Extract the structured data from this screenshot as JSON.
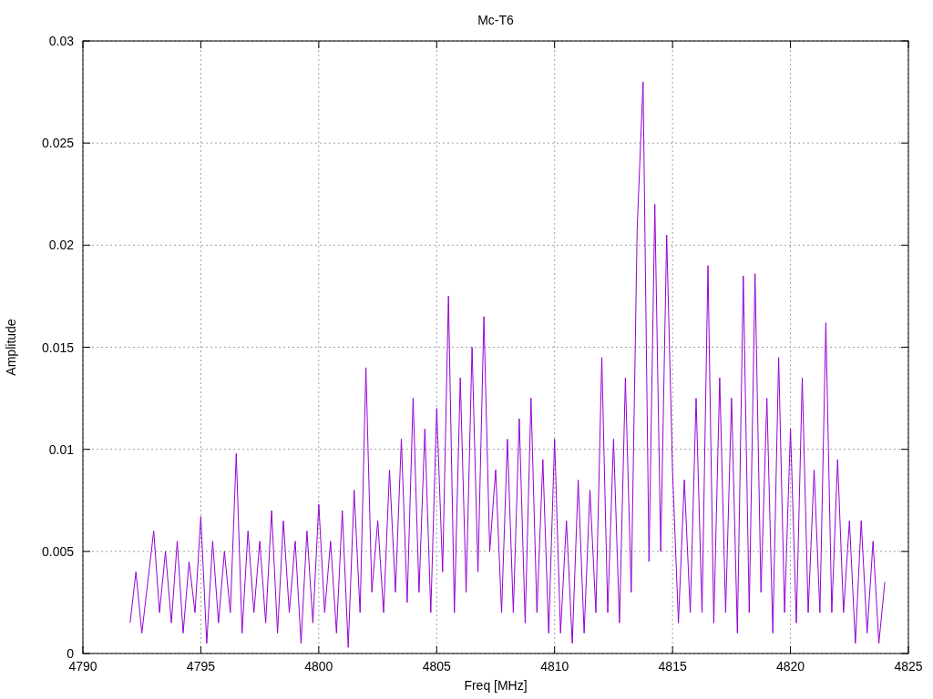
{
  "chart_data": {
    "type": "line",
    "title": "Mc-T6",
    "xlabel": "Freq [MHz]",
    "ylabel": "Amplitude",
    "xlim": [
      4790,
      4825
    ],
    "ylim": [
      0,
      0.03
    ],
    "xticks": [
      4790,
      4795,
      4800,
      4805,
      4810,
      4815,
      4820,
      4825
    ],
    "yticks": [
      0,
      0.005,
      0.01,
      0.015,
      0.02,
      0.025,
      0.03
    ],
    "grid": true,
    "x": [
      4792,
      4792.25,
      4792.5,
      4792.75,
      4793,
      4793.25,
      4793.5,
      4793.75,
      4794,
      4794.25,
      4794.5,
      4794.75,
      4795,
      4795.25,
      4795.5,
      4795.75,
      4796,
      4796.25,
      4796.5,
      4796.75,
      4797,
      4797.25,
      4797.5,
      4797.75,
      4798,
      4798.25,
      4798.5,
      4798.75,
      4799,
      4799.25,
      4799.5,
      4799.75,
      4800,
      4800.25,
      4800.5,
      4800.75,
      4801,
      4801.25,
      4801.5,
      4801.75,
      4802,
      4802.25,
      4802.5,
      4802.75,
      4803,
      4803.25,
      4803.5,
      4803.75,
      4804,
      4804.25,
      4804.5,
      4804.75,
      4805,
      4805.25,
      4805.5,
      4805.75,
      4806,
      4806.25,
      4806.5,
      4806.75,
      4807,
      4807.25,
      4807.5,
      4807.75,
      4808,
      4808.25,
      4808.5,
      4808.75,
      4809,
      4809.25,
      4809.5,
      4809.75,
      4810,
      4810.25,
      4810.5,
      4810.75,
      4811,
      4811.25,
      4811.5,
      4811.75,
      4812,
      4812.25,
      4812.5,
      4812.75,
      4813,
      4813.25,
      4813.5,
      4813.75,
      4814,
      4814.25,
      4814.5,
      4814.75,
      4815,
      4815.25,
      4815.5,
      4815.75,
      4816,
      4816.25,
      4816.5,
      4816.75,
      4817,
      4817.25,
      4817.5,
      4817.75,
      4818,
      4818.25,
      4818.5,
      4818.75,
      4819,
      4819.25,
      4819.5,
      4819.75,
      4820,
      4820.25,
      4820.5,
      4820.75,
      4821,
      4821.25,
      4821.5,
      4821.75,
      4822,
      4822.25,
      4822.5,
      4822.75,
      4823,
      4823.25,
      4823.5,
      4823.75,
      4824
    ],
    "series": [
      {
        "color": "#9400d3",
        "values": [
          0.0015,
          0.004,
          0.001,
          0.0035,
          0.006,
          0.002,
          0.005,
          0.0015,
          0.0055,
          0.001,
          0.0045,
          0.002,
          0.0067,
          0.0005,
          0.0055,
          0.0015,
          0.005,
          0.002,
          0.0098,
          0.001,
          0.006,
          0.002,
          0.0055,
          0.0015,
          0.007,
          0.001,
          0.0065,
          0.002,
          0.0055,
          0.0005,
          0.006,
          0.0015,
          0.0073,
          0.002,
          0.0055,
          0.001,
          0.007,
          0.0003,
          0.008,
          0.002,
          0.014,
          0.003,
          0.0065,
          0.002,
          0.009,
          0.003,
          0.0105,
          0.0025,
          0.0125,
          0.003,
          0.011,
          0.002,
          0.012,
          0.004,
          0.0175,
          0.002,
          0.0135,
          0.003,
          0.015,
          0.004,
          0.0165,
          0.005,
          0.009,
          0.002,
          0.0105,
          0.002,
          0.0115,
          0.0015,
          0.0125,
          0.002,
          0.0095,
          0.001,
          0.0105,
          0.001,
          0.0065,
          0.0005,
          0.0085,
          0.001,
          0.008,
          0.002,
          0.0145,
          0.002,
          0.0105,
          0.0015,
          0.0135,
          0.003,
          0.0208,
          0.028,
          0.0045,
          0.022,
          0.005,
          0.0205,
          0.009,
          0.0015,
          0.0085,
          0.002,
          0.0125,
          0.002,
          0.019,
          0.0015,
          0.0135,
          0.002,
          0.0125,
          0.001,
          0.0185,
          0.002,
          0.0186,
          0.003,
          0.0125,
          0.001,
          0.0145,
          0.002,
          0.011,
          0.0015,
          0.0135,
          0.002,
          0.009,
          0.002,
          0.0162,
          0.002,
          0.0095,
          0.002,
          0.0065,
          0.0005,
          0.0065,
          0.001,
          0.0055,
          0.0005,
          0.0035
        ]
      }
    ]
  }
}
